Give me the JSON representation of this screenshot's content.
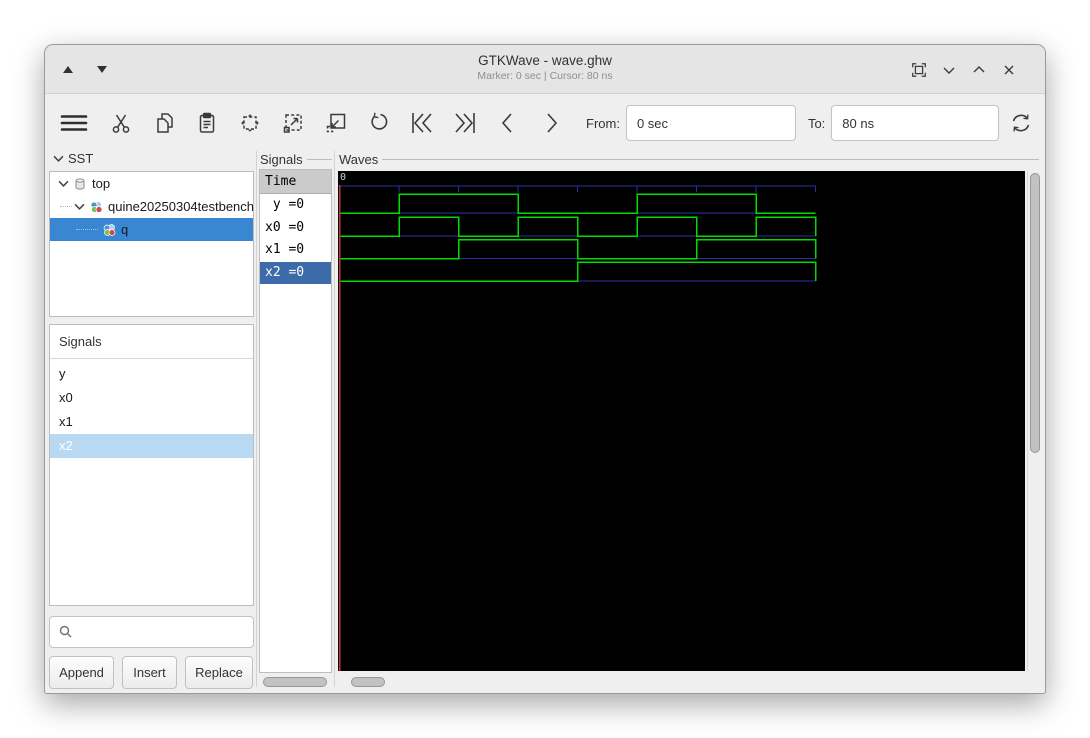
{
  "titlebar": {
    "title": "GTKWave - wave.ghw",
    "subtitle": "Marker: 0 sec  |  Cursor: 80 ns",
    "chrome_icons": [
      "scroll-up-arrow",
      "scroll-down-arrow",
      "fullscreen-icon",
      "unmaximize-icon",
      "maximize-icon",
      "close-icon"
    ]
  },
  "toolbar": {
    "icons": [
      "menu",
      "cut",
      "copy",
      "paste",
      "zoom-fit",
      "zoom-in",
      "zoom-out",
      "undo",
      "go-to-start",
      "go-to-end",
      "go-back",
      "go-forward",
      "reload"
    ],
    "from_label": "From:",
    "from_value": "0 sec",
    "to_label": "To:",
    "to_value": "80 ns"
  },
  "sst": {
    "header": "SST",
    "nodes": [
      {
        "label": "top",
        "level": 0,
        "selected": false
      },
      {
        "label": "quine20250304testbench",
        "level": 1,
        "selected": false
      },
      {
        "label": "q",
        "level": 2,
        "selected": true
      }
    ]
  },
  "signal_list": {
    "header": "Signals",
    "items": [
      "y",
      "x0",
      "x1",
      "x2"
    ],
    "selected": "x2"
  },
  "search": {
    "placeholder": ""
  },
  "buttons": {
    "append": "Append",
    "insert": "Insert",
    "replace": "Replace"
  },
  "values_panel": {
    "frame_label": "Signals",
    "time_header": "Time",
    "rows": [
      {
        "name": "y",
        "value": "=0",
        "selected": false
      },
      {
        "name": "x0",
        "value": "=0",
        "selected": false
      },
      {
        "name": "x1",
        "value": "=0",
        "selected": false
      },
      {
        "name": "x2",
        "value": "=0",
        "selected": true
      }
    ]
  },
  "waves": {
    "frame_label": "Waves",
    "origin_label": "0",
    "t_start_ns": 0,
    "t_end_ns": 80,
    "tick_ns": 10,
    "cursor_ns": 0,
    "signals": [
      {
        "name": "y",
        "initial": 0,
        "edges_ns": [
          10,
          30,
          50,
          70
        ]
      },
      {
        "name": "x0",
        "initial": 0,
        "edges_ns": [
          10,
          20,
          30,
          40,
          50,
          60,
          70
        ]
      },
      {
        "name": "x1",
        "initial": 0,
        "edges_ns": [
          20,
          40,
          60
        ]
      },
      {
        "name": "x2",
        "initial": 0,
        "edges_ns": [
          40
        ]
      }
    ]
  },
  "colors": {
    "accent": "#3987d3",
    "selection_dim": "#b9d9f2",
    "selection_values": "#3d6aa8",
    "wave_trace": "#00dc00",
    "wave_grid": "#2e2ea2",
    "wave_cursor": "#bf3a3a",
    "wave_bg": "#000000",
    "wave_label": "#cfcfcf"
  }
}
